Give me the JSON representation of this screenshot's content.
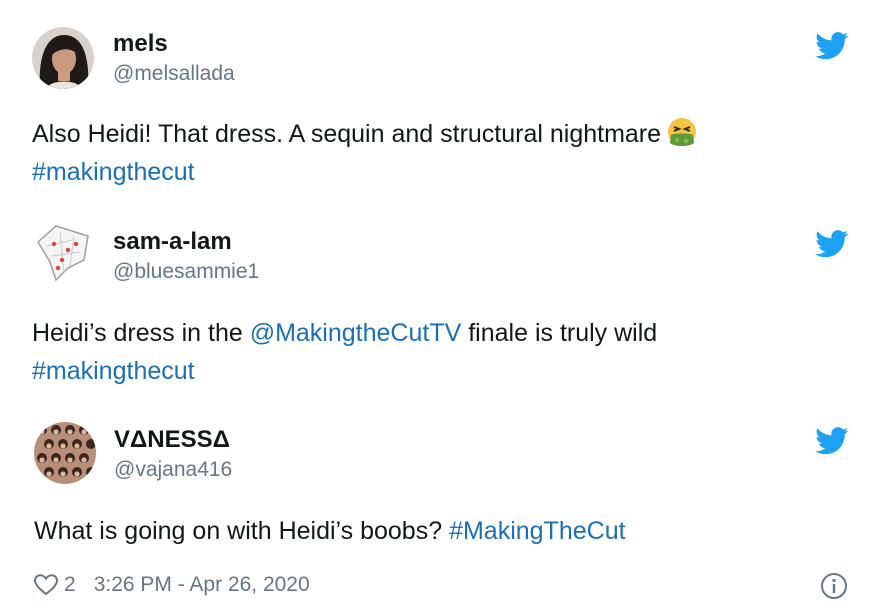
{
  "tweets": [
    {
      "name": "mels",
      "handle": "@melsallada",
      "text_before": "Also Heidi! That dress. A sequin and structural nightmare",
      "emoji": "nauseated-face-icon",
      "hashtag": "#makingthecut"
    },
    {
      "name": "sam-a-lam",
      "handle": "@bluesammie1",
      "text_before": "Heidi’s dress in the ",
      "mention": "@MakingtheCutTV",
      "text_after": " finale is truly wild",
      "hashtag": "#makingthecut"
    },
    {
      "name": "VΔNESSΔ",
      "handle": "@vajana416",
      "text_before": "What is going on with Heidi’s boobs? ",
      "hashtag": "#MakingTheCut",
      "likes": "2",
      "timestamp": "3:26 PM - Apr 26, 2020"
    }
  ],
  "colors": {
    "twitter_blue": "#1da1f2",
    "link": "#1b6fb5",
    "secondary_text": "#657786"
  }
}
